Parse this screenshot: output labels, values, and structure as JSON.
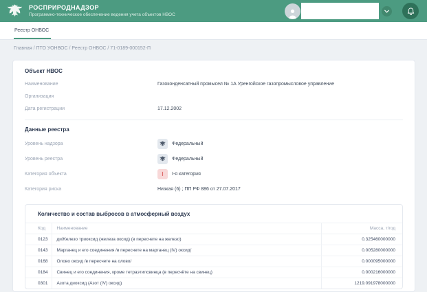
{
  "header": {
    "title": "РОСПРИРОДНАДЗОР",
    "subtitle": "Программно-техническое обеспечение ведения учета объектов НВОС",
    "accent_color": "#4c9b81",
    "icons": {
      "logo": "double-eagle-icon",
      "avatar": "user-icon",
      "dropdown": "chevron-down-icon",
      "notifications": "bell-icon"
    }
  },
  "tabbar": {
    "active_tab": "Реестр ОНВОС"
  },
  "breadcrumb": {
    "path": "Главная / ПТО УОНВОС / Реестр ОНВОС / 71-0189-000152-П"
  },
  "object_card": {
    "title": "Объект НВОС",
    "fields": [
      {
        "label": "Наименование",
        "value": "Газоконденсатный промысел № 1А Уренгойское газопромысловое управление"
      },
      {
        "label": "Организация",
        "value": ""
      },
      {
        "label": "Дата регистрации",
        "value": "17.12.2002"
      }
    ]
  },
  "registry_card": {
    "title": "Данные реестра",
    "fields": [
      {
        "label": "Уровень надзора",
        "value": "Федеральный",
        "icon": "eagle-icon"
      },
      {
        "label": "Уровень реестра",
        "value": "Федеральный",
        "icon": "eagle-icon"
      },
      {
        "label": "Категория объекта",
        "value": "I-я категория",
        "badge": "I",
        "badge_bg": "#f8d8d8",
        "badge_color": "#dd6a6a"
      },
      {
        "label": "Категория риска",
        "value": "Низкая (6) ;  ПП РФ 886 от 27.07.2017"
      }
    ]
  },
  "emissions_table": {
    "title": "Количество и состав выбросов в атмосферный воздух",
    "columns": {
      "code": "Код",
      "name": "Наименование",
      "mass": "Масса, т/год"
    },
    "rows": [
      {
        "code": "0123",
        "name": "диЖелезо триоксид (железа оксид) (в пересчете на железо)",
        "mass": "0.325460000000"
      },
      {
        "code": "0143",
        "name": "Марганец и его соединения /в пересчете на марганец (IV) оксид/",
        "mass": "0.005280000000"
      },
      {
        "code": "0168",
        "name": "Олово оксид /в пересчете на олово/",
        "mass": "0.000095000000"
      },
      {
        "code": "0184",
        "name": "Свинец и его соединения, кроме тетраэтилсвинца (в пересчёте на свинец)",
        "mass": "0.000216000000"
      },
      {
        "code": "0301",
        "name": "Азота диоксид (Азот (IV) оксид)",
        "mass": "1219.091978000000"
      }
    ]
  }
}
